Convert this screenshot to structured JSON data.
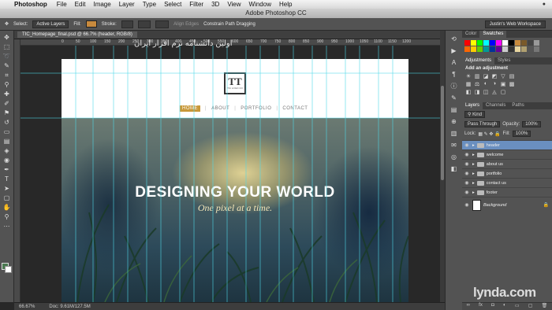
{
  "menubar": {
    "items": [
      "Photoshop",
      "File",
      "Edit",
      "Image",
      "Layer",
      "Type",
      "Select",
      "Filter",
      "3D",
      "View",
      "Window",
      "Help"
    ],
    "right_text": "●"
  },
  "window": {
    "title": "Adobe Photoshop CC"
  },
  "options_bar": {
    "select_label": "Select:",
    "select_value": "Active Layers",
    "fill_label": "Fill:",
    "stroke_label": "Stroke:",
    "align_edges": "Align Edges",
    "constrain": "Constrain Path Dragging",
    "workspace": "Justin's Web Workspace",
    "fill_color": "#c88a3d"
  },
  "document": {
    "tab_label": "TIC_Homepage_final.psd @ 66.7% (header, RGB/8)",
    "watermark": "اولین دانشنامه نرم افزار ایران",
    "nav": [
      "HOME",
      "ABOUT",
      "PORTFOLIO",
      "CONTACT"
    ],
    "hero_title": "DESIGNING YOUR WORLD",
    "hero_subtitle": "One pixel at a time.",
    "logo_letters": "TT",
    "logo_caption": "TIC LOGO CO"
  },
  "ruler": {
    "ticks": [
      "0",
      "50",
      "100",
      "150",
      "200",
      "250",
      "300",
      "350",
      "400",
      "450",
      "500",
      "550",
      "600",
      "650",
      "700",
      "750",
      "800",
      "850",
      "900",
      "950",
      "1000",
      "1050",
      "1100",
      "1150",
      "1200"
    ]
  },
  "status": {
    "zoom": "66.67%",
    "doc": "Doc: 9.61M/127.5M"
  },
  "right_panels": {
    "color_tabs": [
      "Color",
      "Swatches"
    ],
    "swatches": [
      "#ff0000",
      "#ffff00",
      "#00ff00",
      "#00ffff",
      "#0000ff",
      "#ff00ff",
      "#ffffff",
      "#000000",
      "#c88a3d",
      "#7a5a2a",
      "#444444",
      "#999999",
      "#ff6600",
      "#ffcc00",
      "#66cc00",
      "#009999",
      "#003399",
      "#660099",
      "#cccccc",
      "#333333",
      "#e8d6a0",
      "#b0a070",
      "#555555",
      "#777777"
    ],
    "adj_tabs": [
      "Adjustments",
      "Styles"
    ],
    "adj_title": "Add an adjustment",
    "adj_row1": [
      "☀",
      "▥",
      "◪",
      "◩",
      "▽",
      "▤"
    ],
    "adj_row2": [
      "▦",
      "⚖",
      "◐",
      "◑",
      "▣",
      "▩"
    ],
    "adj_row3": [
      "◧",
      "◨",
      "◫",
      "◬",
      "▢"
    ],
    "layers_tabs": [
      "Layers",
      "Channels",
      "Paths"
    ],
    "kind_label": "Kind",
    "blend_mode": "Pass Through",
    "opacity_label": "Opacity:",
    "opacity_value": "100%",
    "lock_label": "Lock:",
    "fill_label": "Fill:",
    "fill_value": "100%",
    "layers": [
      "header",
      "welcome",
      "about us",
      "portfolio",
      "contact us",
      "footer",
      "Background"
    ]
  },
  "brand": "lynda.com"
}
